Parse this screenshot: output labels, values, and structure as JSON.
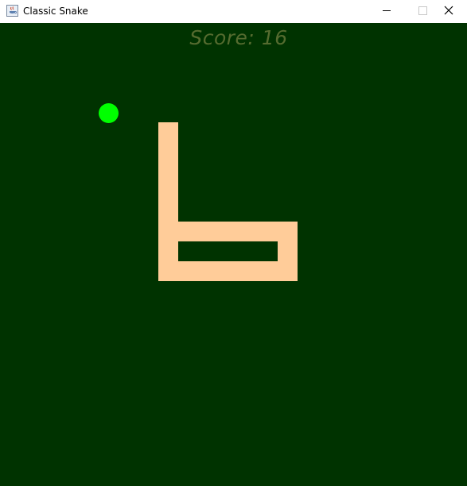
{
  "window": {
    "title": "Classic Snake",
    "icon": "java-cup-icon",
    "controls": [
      "minimize-icon",
      "maximize-icon",
      "close-icon"
    ]
  },
  "game": {
    "score_label": "Score:",
    "score_value": "16",
    "colors": {
      "background": "#003300",
      "snake": "#ffcc99",
      "apple": "#00ff00",
      "score_text": "#556b2f"
    }
  }
}
